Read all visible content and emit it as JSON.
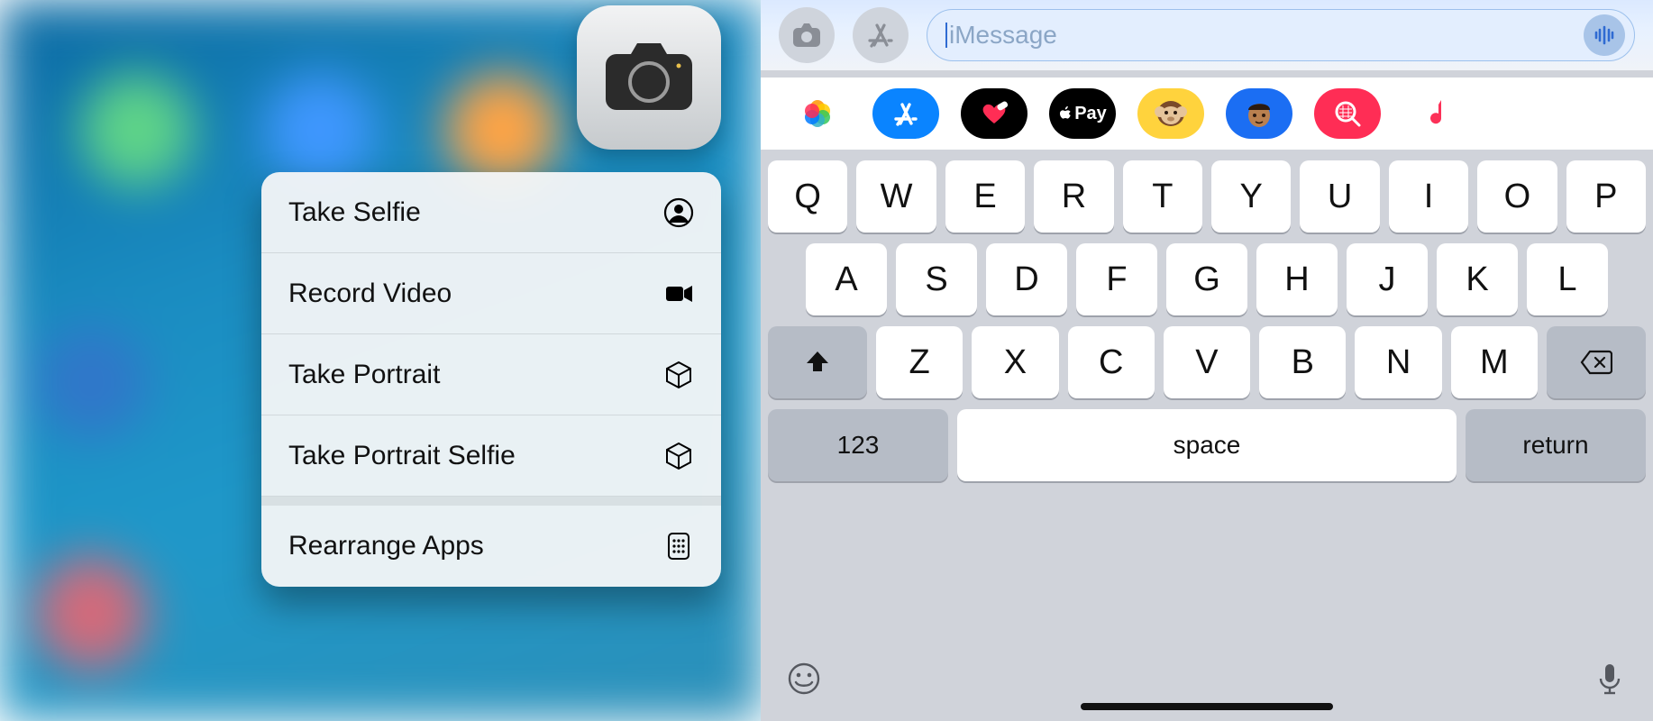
{
  "left": {
    "app_icon": "camera-app",
    "menu": {
      "items": [
        {
          "label": "Take Selfie",
          "icon": "person-circle"
        },
        {
          "label": "Record Video",
          "icon": "video-camera"
        },
        {
          "label": "Take Portrait",
          "icon": "cube"
        },
        {
          "label": "Take Portrait Selfie",
          "icon": "cube"
        }
      ],
      "separator_after_index": 3,
      "footer_item": {
        "label": "Rearrange Apps",
        "icon": "apps-grid"
      }
    }
  },
  "right": {
    "compose": {
      "placeholder": "iMessage",
      "camera_button": "camera",
      "appstore_button": "app-store",
      "voice_button": "waveform"
    },
    "app_strip": [
      {
        "name": "photos",
        "bg": "#ffffff"
      },
      {
        "name": "appstore",
        "bg": "#0a84ff"
      },
      {
        "name": "fitness",
        "bg": "#000000",
        "accent": "#ff2d55"
      },
      {
        "name": "applepay",
        "bg": "#000000",
        "label": "Pay"
      },
      {
        "name": "animoji",
        "bg": "#ffd33d"
      },
      {
        "name": "memoji",
        "bg": "#1b6ef3"
      },
      {
        "name": "search",
        "bg": "#ff2d55"
      },
      {
        "name": "music",
        "bg": "#ffffff",
        "accent": "#fc3158"
      }
    ],
    "keyboard": {
      "row1": [
        "Q",
        "W",
        "E",
        "R",
        "T",
        "Y",
        "U",
        "I",
        "O",
        "P"
      ],
      "row2": [
        "A",
        "S",
        "D",
        "F",
        "G",
        "H",
        "J",
        "K",
        "L"
      ],
      "row3": [
        "Z",
        "X",
        "C",
        "V",
        "B",
        "N",
        "M"
      ],
      "shift_icon": "shift",
      "backspace_icon": "backspace",
      "numbers_label": "123",
      "space_label": "space",
      "return_label": "return",
      "emoji_icon": "emoji-smile",
      "mic_icon": "microphone"
    }
  }
}
